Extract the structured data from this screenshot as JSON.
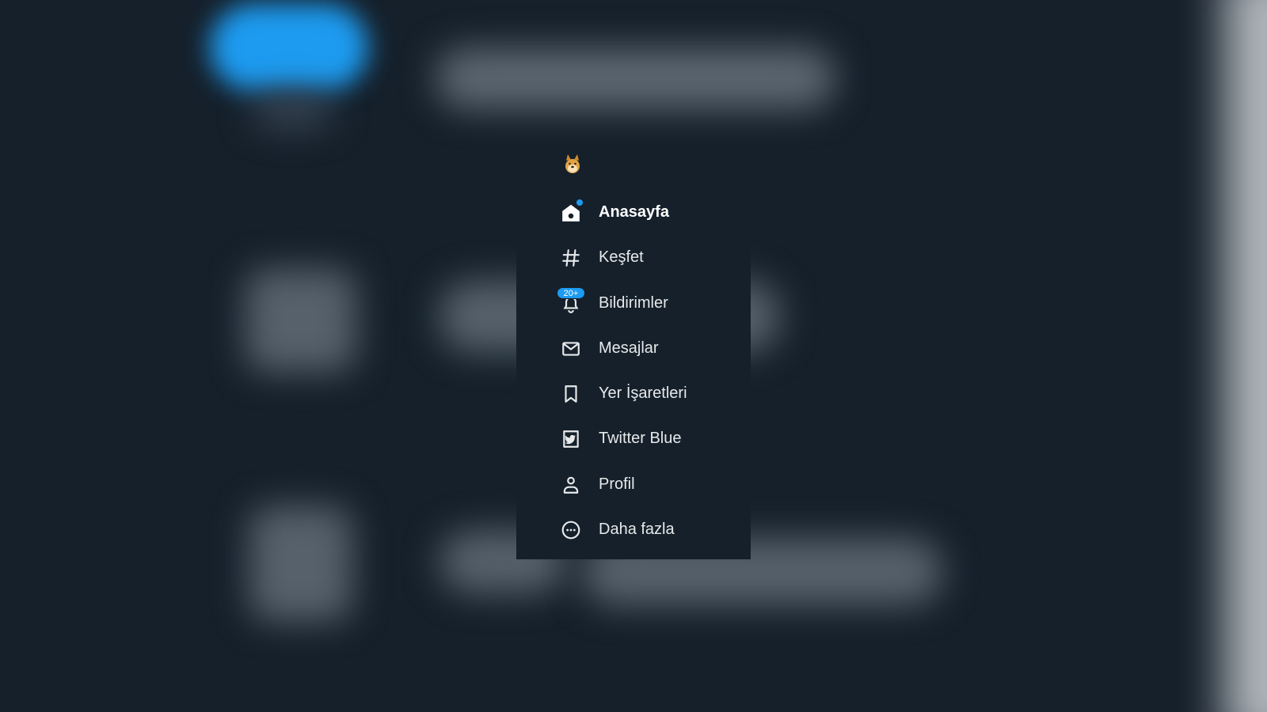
{
  "colors": {
    "background": "#15202b",
    "accent": "#1d9bf0",
    "text": "#e7e9ea"
  },
  "logo": {
    "icon": "doge-dog-icon"
  },
  "nav": {
    "items": [
      {
        "label": "Anasayfa",
        "icon": "home-icon",
        "active": true,
        "has_dot": true
      },
      {
        "label": "Keşfet",
        "icon": "hashtag-icon",
        "active": false
      },
      {
        "label": "Bildirimler",
        "icon": "bell-icon",
        "active": false,
        "badge": "20+"
      },
      {
        "label": "Mesajlar",
        "icon": "envelope-icon",
        "active": false
      },
      {
        "label": "Yer İşaretleri",
        "icon": "bookmark-icon",
        "active": false
      },
      {
        "label": "Twitter Blue",
        "icon": "twitter-blue-icon",
        "active": false
      },
      {
        "label": "Profil",
        "icon": "person-icon",
        "active": false
      },
      {
        "label": "Daha fazla",
        "icon": "more-circle-icon",
        "active": false
      }
    ]
  }
}
